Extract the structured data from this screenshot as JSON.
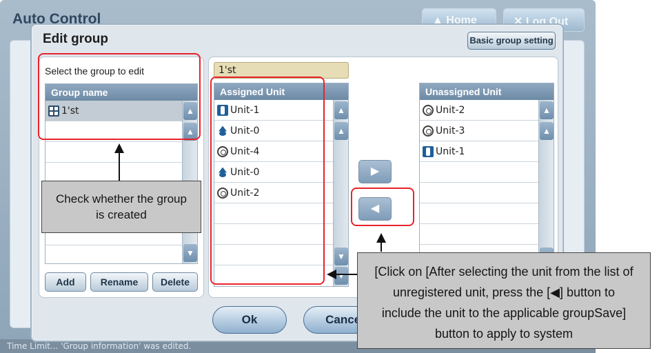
{
  "background": {
    "app_title": "Auto Control",
    "home_label": "Home",
    "logout_label": "Log Out",
    "status_text": "Time Limit... 'Group information' was edited."
  },
  "dialog": {
    "title": "Edit group",
    "basic_group_setting_label": "Basic group setting",
    "select_label": "Select the group to edit",
    "group_list": {
      "header": "Group name",
      "items": [
        {
          "label": "1'st",
          "icon": "group-icon",
          "selected": true
        }
      ]
    },
    "add_label": "Add",
    "rename_label": "Rename",
    "delete_label": "Delete",
    "group_name_value": "1'st",
    "assigned": {
      "header": "Assigned Unit",
      "items": [
        {
          "label": "Unit-1",
          "icon": "indoor-unit-icon"
        },
        {
          "label": "Unit-0",
          "icon": "ventilator-icon"
        },
        {
          "label": "Unit-4",
          "icon": "ahu-icon"
        },
        {
          "label": "Unit-0",
          "icon": "ventilator-icon"
        },
        {
          "label": "Unit-2",
          "icon": "ahu-icon"
        }
      ]
    },
    "unassigned": {
      "header": "Unassigned Unit",
      "items": [
        {
          "label": "Unit-2",
          "icon": "ahu-icon"
        },
        {
          "label": "Unit-3",
          "icon": "ahu-icon"
        },
        {
          "label": "Unit-1",
          "icon": "indoor-unit-icon"
        }
      ]
    },
    "ok_label": "Ok",
    "cancel_label": "Cancel"
  },
  "annotations": {
    "note1_line1": "Check whether the group",
    "note1_line2": "is created",
    "note2_line1": "[Click on [After selecting the unit from the list of",
    "note2_line2": "unregistered unit, press the [◀] button to",
    "note2_line3": "include the unit to the applicable groupSave]",
    "note2_line4": "button to apply to system"
  },
  "colors": {
    "accent": "#6d8aa5",
    "highlight": "#e8222a",
    "selected_row": "#c3ccd4"
  }
}
